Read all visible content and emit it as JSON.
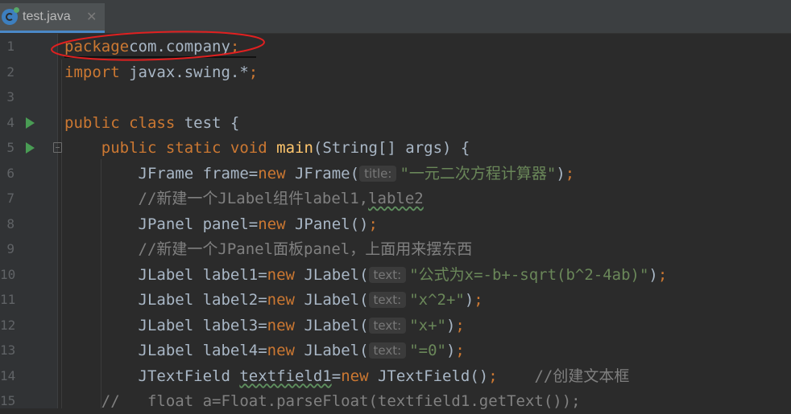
{
  "tab": {
    "title": "test.java",
    "close": "✕",
    "icon": "java-class-icon"
  },
  "lines": [
    {
      "n": "1",
      "segs": [
        [
          "kw",
          "package"
        ],
        [
          "",
          "com.company"
        ],
        [
          "kw",
          ";"
        ]
      ]
    },
    {
      "n": "2",
      "segs": [
        [
          "kw",
          "import"
        ],
        [
          "",
          " javax.swing.*"
        ],
        [
          "kw",
          ";"
        ]
      ]
    },
    {
      "n": "3",
      "segs": []
    },
    {
      "n": "4",
      "segs": [
        [
          "kw",
          "public class"
        ],
        [
          "",
          " test {"
        ]
      ]
    },
    {
      "n": "5",
      "segs": [
        [
          "",
          "    "
        ],
        [
          "kw",
          "public static void"
        ],
        [
          "",
          " "
        ],
        [
          "fn",
          "main"
        ],
        [
          "",
          "(String[] args) {"
        ]
      ]
    },
    {
      "n": "6",
      "segs": [
        [
          "",
          "        JFrame frame="
        ],
        [
          "kw",
          "new"
        ],
        [
          "",
          " JFrame("
        ],
        [
          "hint",
          "title:"
        ],
        [
          "str",
          "\"一元二次方程计算器\""
        ],
        [
          "",
          ")"
        ],
        [
          "kw",
          ";"
        ]
      ]
    },
    {
      "n": "7",
      "segs": [
        [
          "",
          "        "
        ],
        [
          "com",
          "//新建一个JLabel组件label1,"
        ],
        [
          "comsq",
          "lable2"
        ]
      ]
    },
    {
      "n": "8",
      "segs": [
        [
          "",
          "        JPanel panel="
        ],
        [
          "kw",
          "new"
        ],
        [
          "",
          " JPanel()"
        ],
        [
          "kw",
          ";"
        ]
      ]
    },
    {
      "n": "9",
      "segs": [
        [
          "",
          "        "
        ],
        [
          "com",
          "//新建一个JPanel面板panel，上面用来摆东西"
        ]
      ]
    },
    {
      "n": "10",
      "segs": [
        [
          "",
          "        JLabel label1="
        ],
        [
          "kw",
          "new"
        ],
        [
          "",
          " JLabel("
        ],
        [
          "hint",
          "text:"
        ],
        [
          "str",
          "\"公式为x=-b+-sqrt(b^2-4ab)\""
        ],
        [
          "",
          ")"
        ],
        [
          "kw",
          ";"
        ]
      ]
    },
    {
      "n": "11",
      "segs": [
        [
          "",
          "        JLabel label2="
        ],
        [
          "kw",
          "new"
        ],
        [
          "",
          " JLabel("
        ],
        [
          "hint",
          "text:"
        ],
        [
          "str",
          "\"x^2+\""
        ],
        [
          "",
          ")"
        ],
        [
          "kw",
          ";"
        ]
      ]
    },
    {
      "n": "12",
      "segs": [
        [
          "",
          "        JLabel label3="
        ],
        [
          "kw",
          "new"
        ],
        [
          "",
          " JLabel("
        ],
        [
          "hint",
          "text:"
        ],
        [
          "str",
          "\"x+\""
        ],
        [
          "",
          ")"
        ],
        [
          "kw",
          ";"
        ]
      ]
    },
    {
      "n": "13",
      "segs": [
        [
          "",
          "        JLabel label4="
        ],
        [
          "kw",
          "new"
        ],
        [
          "",
          " JLabel("
        ],
        [
          "hint",
          "text:"
        ],
        [
          "str",
          "\"=0\""
        ],
        [
          "",
          ")"
        ],
        [
          "kw",
          ";"
        ]
      ]
    },
    {
      "n": "14",
      "segs": [
        [
          "",
          "        JTextField "
        ],
        [
          "sq",
          "textfield1"
        ],
        [
          "",
          "="
        ],
        [
          "kw",
          "new"
        ],
        [
          "",
          " JTextField()"
        ],
        [
          "kw",
          ";"
        ],
        [
          "",
          "    "
        ],
        [
          "com",
          "//创建文本框"
        ]
      ]
    },
    {
      "n": "15",
      "segs": [
        [
          "com",
          "    //   float a=Float.parseFloat(textfield1.getText());"
        ]
      ]
    }
  ],
  "colors": {
    "keyword": "#cc7832",
    "string": "#6a8759",
    "comment": "#808080",
    "function": "#ffc66d",
    "text": "#a9b7c6",
    "run": "#499c54",
    "annotation": "#e02020"
  },
  "gutter_icons": {
    "run_lines": [
      "4",
      "5"
    ],
    "override_line": "5",
    "run_icon": "run-arrow-icon",
    "override_icon": "override-marker-icon"
  }
}
